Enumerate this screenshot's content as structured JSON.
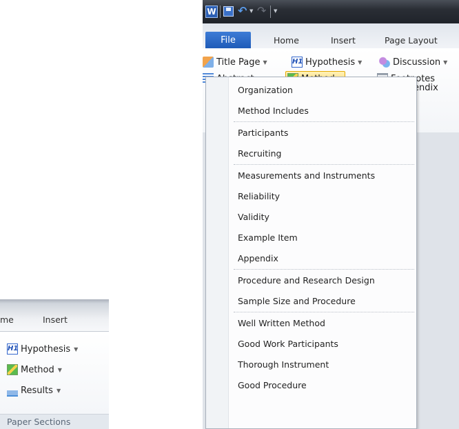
{
  "inset": {
    "tabs": [
      "me",
      "Insert"
    ],
    "items": [
      {
        "label": "Hypothesis",
        "icon": "h1-icon"
      },
      {
        "label": "Method",
        "icon": "method-icon"
      },
      {
        "label": "Results",
        "icon": "results-icon"
      }
    ],
    "group_label": "Paper Sections"
  },
  "titlebar": {
    "app_icon_letter": "W",
    "qat": [
      "save-icon",
      "undo-icon",
      "redo-icon"
    ]
  },
  "tabs": {
    "file": "File",
    "items": [
      "Home",
      "Insert",
      "Page Layout"
    ]
  },
  "ribbon": {
    "row1": [
      {
        "label": "Title Page",
        "icon": "title-page-icon",
        "dropdown": true
      },
      {
        "label": "Hypothesis",
        "icon": "h1-icon",
        "dropdown": true
      },
      {
        "label": "Discussion",
        "icon": "discussion-icon",
        "dropdown": true
      }
    ],
    "row2": [
      {
        "label": "Abstract",
        "icon": "abstract-icon",
        "dropdown": true
      },
      {
        "label": "Method",
        "icon": "method-icon",
        "dropdown": true,
        "active": true
      },
      {
        "label": "Footnotes",
        "icon": "footnotes-icon",
        "dropdown": false
      }
    ],
    "row3_partial": "endix"
  },
  "method_menu": {
    "groups": [
      [
        "Organization",
        "Method Includes"
      ],
      [
        "Participants",
        "Recruiting"
      ],
      [
        "Measurements and Instruments",
        "Reliability",
        "Validity",
        "Example Item",
        "Appendix"
      ],
      [
        "Procedure and Research Design",
        "Sample Size and Procedure"
      ],
      [
        "Well Written Method",
        "Good Work Participants",
        "Thorough Instrument",
        "Good Procedure"
      ]
    ]
  },
  "colors": {
    "file_tab": "#1f5bb8",
    "active_button": "#ffd66b",
    "titlebar": "#2a2e35"
  }
}
